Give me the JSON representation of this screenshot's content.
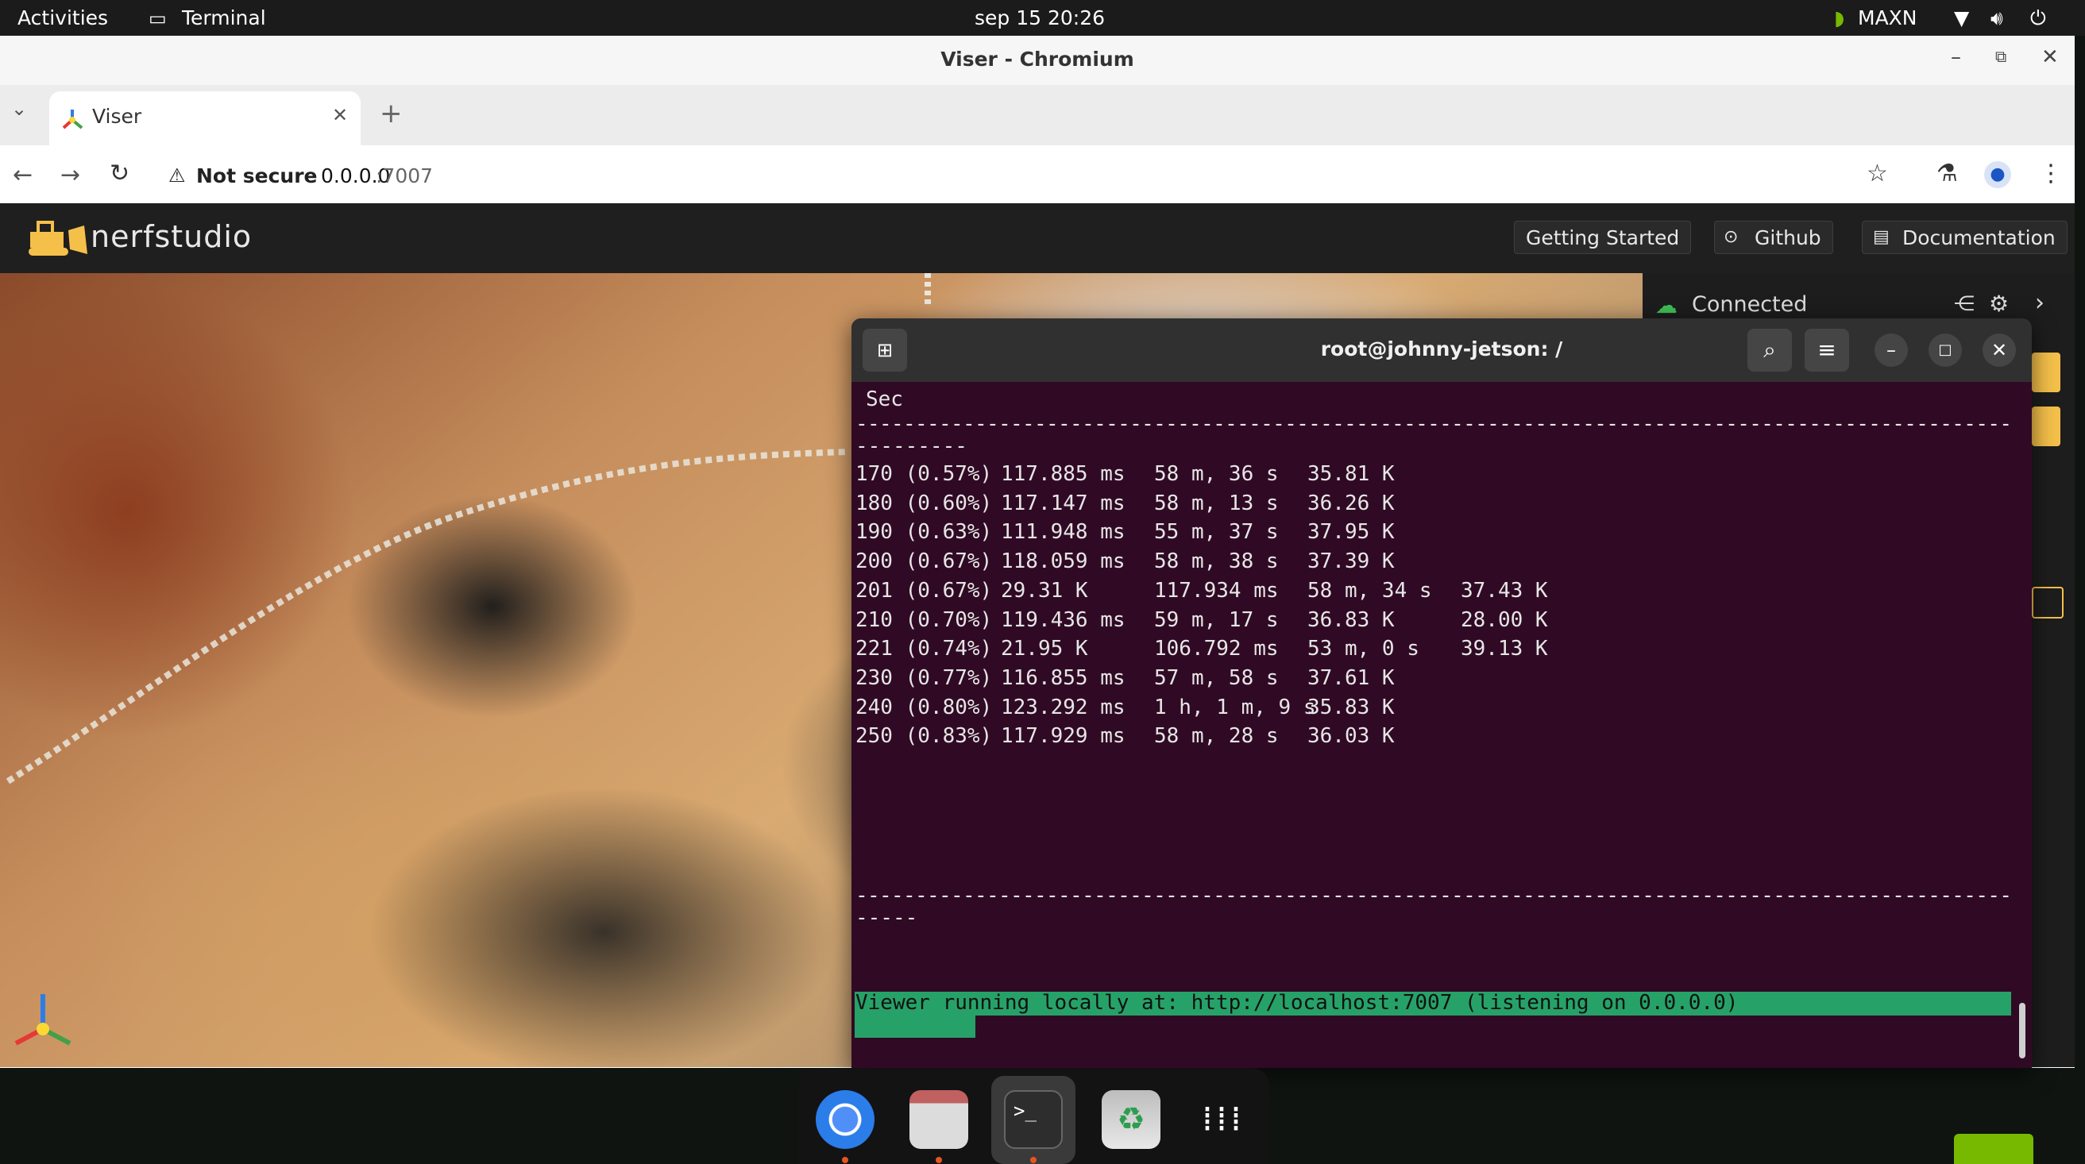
{
  "topbar": {
    "activities": "Activities",
    "app_name": "Terminal",
    "clock": "sep 15  20:26",
    "nvidia_mode": "MAXN"
  },
  "browser": {
    "window_title": "Viser - Chromium",
    "tab_title": "Viser",
    "security_label": "Not secure",
    "url_host": "0.0.0.0",
    "url_port": ":7007"
  },
  "nerfstudio": {
    "logo_text": "nerfstudio",
    "nav": {
      "getting_started": "Getting Started",
      "github": "Github",
      "documentation": "Documentation"
    },
    "status": "Connected"
  },
  "terminal": {
    "title": "root@johnny-jetson: /",
    "header_tail": "Sec",
    "divider_top": "-------------------------------------------------------------------------------------------------",
    "divider_top_wrap": "---------",
    "rows": [
      {
        "step": "170 (0.57%)",
        "c2": "117.885 ms",
        "c3": "58 m, 36 s",
        "c4": "35.81 K",
        "c5": ""
      },
      {
        "step": "180 (0.60%)",
        "c2": "117.147 ms",
        "c3": "58 m, 13 s",
        "c4": "36.26 K",
        "c5": ""
      },
      {
        "step": "190 (0.63%)",
        "c2": "111.948 ms",
        "c3": "55 m, 37 s",
        "c4": "37.95 K",
        "c5": ""
      },
      {
        "step": "200 (0.67%)",
        "c2": "118.059 ms",
        "c3": "58 m, 38 s",
        "c4": "37.39 K",
        "c5": ""
      },
      {
        "step": "201 (0.67%)",
        "c2": "29.31 K",
        "c3": "117.934 ms",
        "c4": "58 m, 34 s",
        "c5": "37.43 K"
      },
      {
        "step": "210 (0.70%)",
        "c2": "119.436 ms",
        "c3": "59 m, 17 s",
        "c4": "36.83 K",
        "c5": "28.00 K"
      },
      {
        "step": "221 (0.74%)",
        "c2": "21.95 K",
        "c3": "106.792 ms",
        "c4": "53 m, 0 s",
        "c5": "39.13 K"
      },
      {
        "step": "230 (0.77%)",
        "c2": "116.855 ms",
        "c3": "57 m, 58 s",
        "c4": "37.61 K",
        "c5": ""
      },
      {
        "step": "240 (0.80%)",
        "c2": "123.292 ms",
        "c3": "1 h, 1 m, 9 s",
        "c4": "35.83 K",
        "c5": ""
      },
      {
        "step": "250 (0.83%)",
        "c2": "117.929 ms",
        "c3": "58 m, 28 s",
        "c4": "36.03 K",
        "c5": ""
      }
    ],
    "divider_bottom": "-------------------------------------------------------------------------------------------------",
    "divider_bottom_wrap": "-----",
    "banner": "Viewer running locally at: http://localhost:7007 (listening on 0.0.0.0)"
  },
  "colors": {
    "terminal_bg": "#300a24",
    "banner_bg": "#26a269",
    "nvidia_green": "#76b900"
  },
  "dock": {
    "apps": [
      "chromium-icon",
      "files-icon",
      "terminal-icon",
      "trash-icon",
      "app-grid-icon"
    ]
  }
}
